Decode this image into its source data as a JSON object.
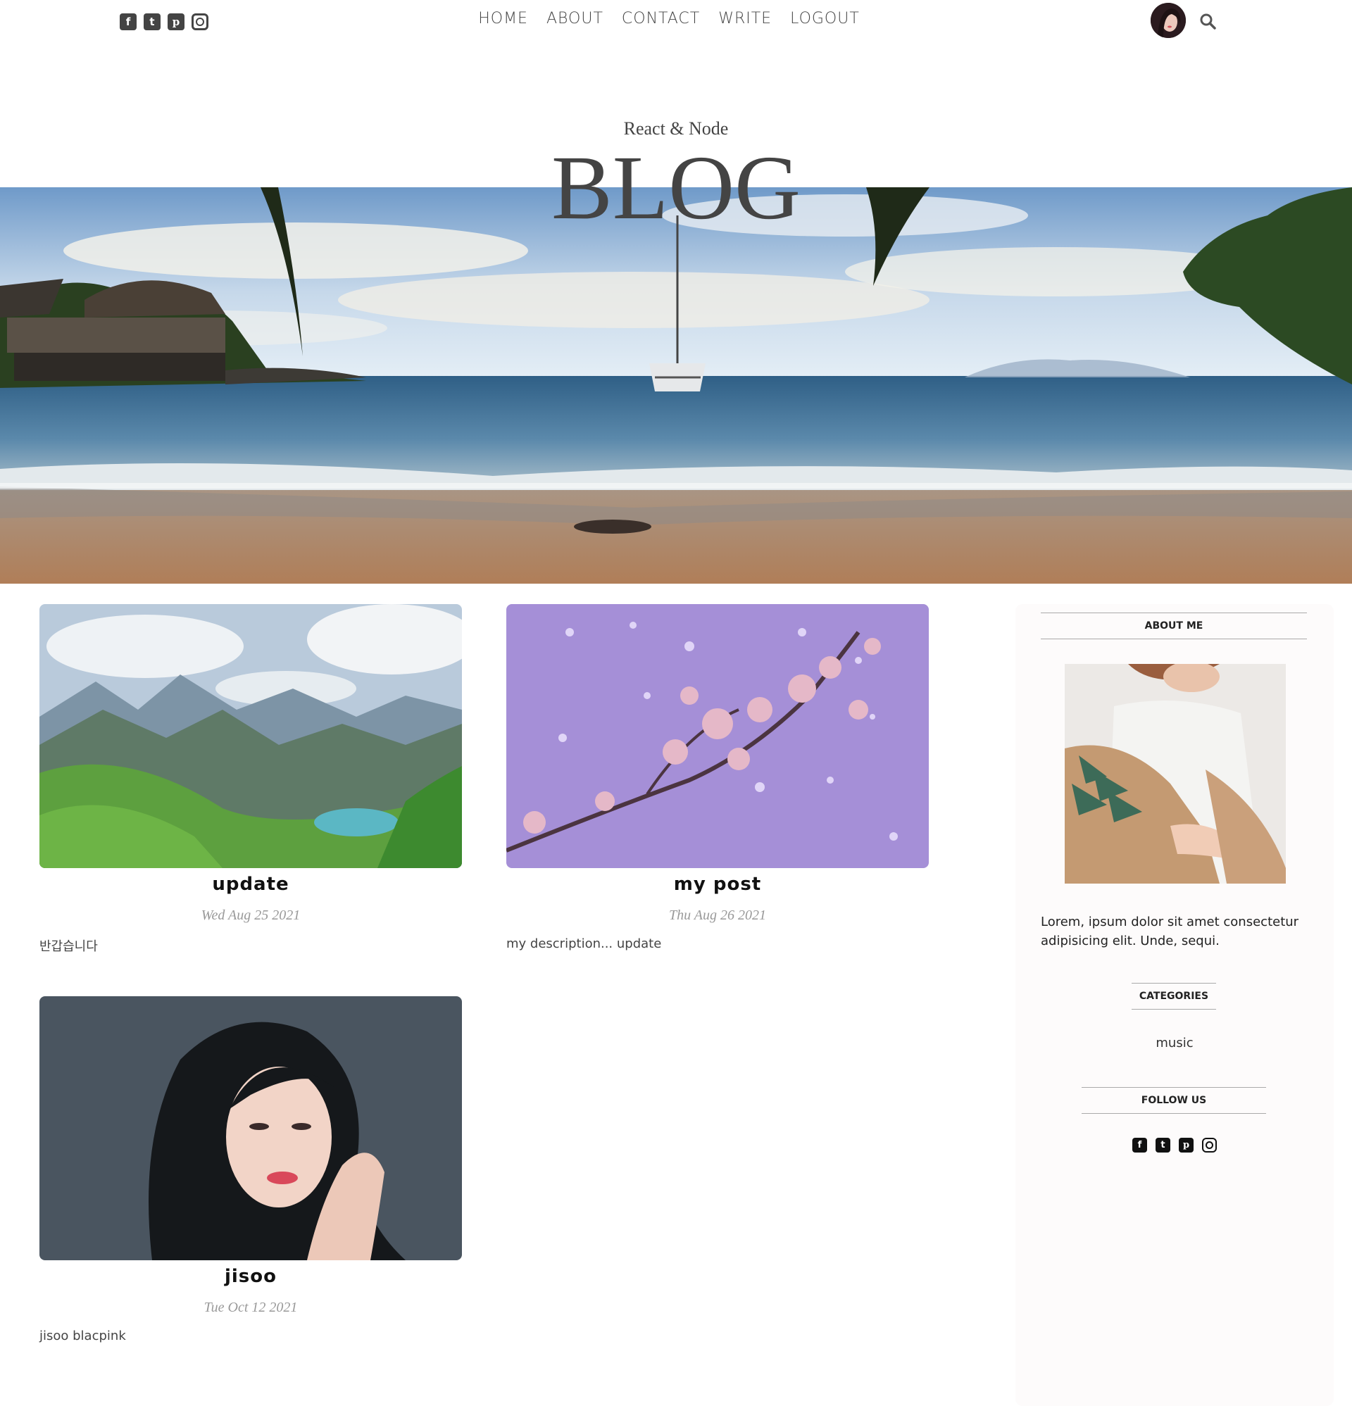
{
  "nav": {
    "items": [
      "HOME",
      "ABOUT",
      "CONTACT",
      "WRITE",
      "LOGOUT"
    ]
  },
  "social_icons": [
    "facebook-square-icon",
    "twitter-square-icon",
    "pinterest-square-icon",
    "instagram-icon"
  ],
  "header": {
    "subtitle": "React & Node",
    "title": "BLOG"
  },
  "posts": [
    {
      "title": "update",
      "date": "Wed Aug 25 2021",
      "desc": "반갑습니다"
    },
    {
      "title": "my post",
      "date": "Thu Aug 26 2021",
      "desc": "my description... update"
    },
    {
      "title": "jisoo",
      "date": "Tue Oct 12 2021",
      "desc": "jisoo blacpink"
    }
  ],
  "sidebar": {
    "about_title": "ABOUT ME",
    "about_text": "Lorem, ipsum dolor sit amet consectetur adipisicing elit. Unde, sequi.",
    "categories_title": "CATEGORIES",
    "categories": [
      "music"
    ],
    "follow_title": "FOLLOW US"
  },
  "colors": {
    "nav_text": "#444444",
    "sidebar_bg": "#fdfbfb",
    "date_text": "#999999"
  }
}
